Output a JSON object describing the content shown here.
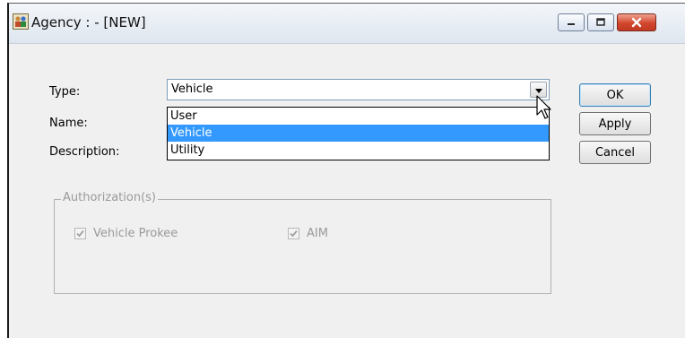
{
  "window": {
    "title": "Agency : - [NEW]",
    "app_icon": "agency-people-icon",
    "controls": [
      "minimize-icon",
      "maximize-icon",
      "close-icon"
    ]
  },
  "form": {
    "type_label": "Type:",
    "name_label": "Name:",
    "description_label": "Description:",
    "type_value": "Vehicle",
    "type_options": [
      "User",
      "Vehicle",
      "Utility"
    ],
    "type_selected_index": 1
  },
  "buttons": {
    "ok": "OK",
    "apply": "Apply",
    "cancel": "Cancel"
  },
  "authorizations": {
    "title": "Authorization(s)",
    "items": [
      {
        "label": "Vehicle Prokee",
        "checked": true,
        "enabled": false
      },
      {
        "label": "AIM",
        "checked": true,
        "enabled": false
      }
    ]
  },
  "colors": {
    "selection": "#3399ff",
    "window_bg": "#f0f0f0",
    "close_button": "#d2462d"
  }
}
